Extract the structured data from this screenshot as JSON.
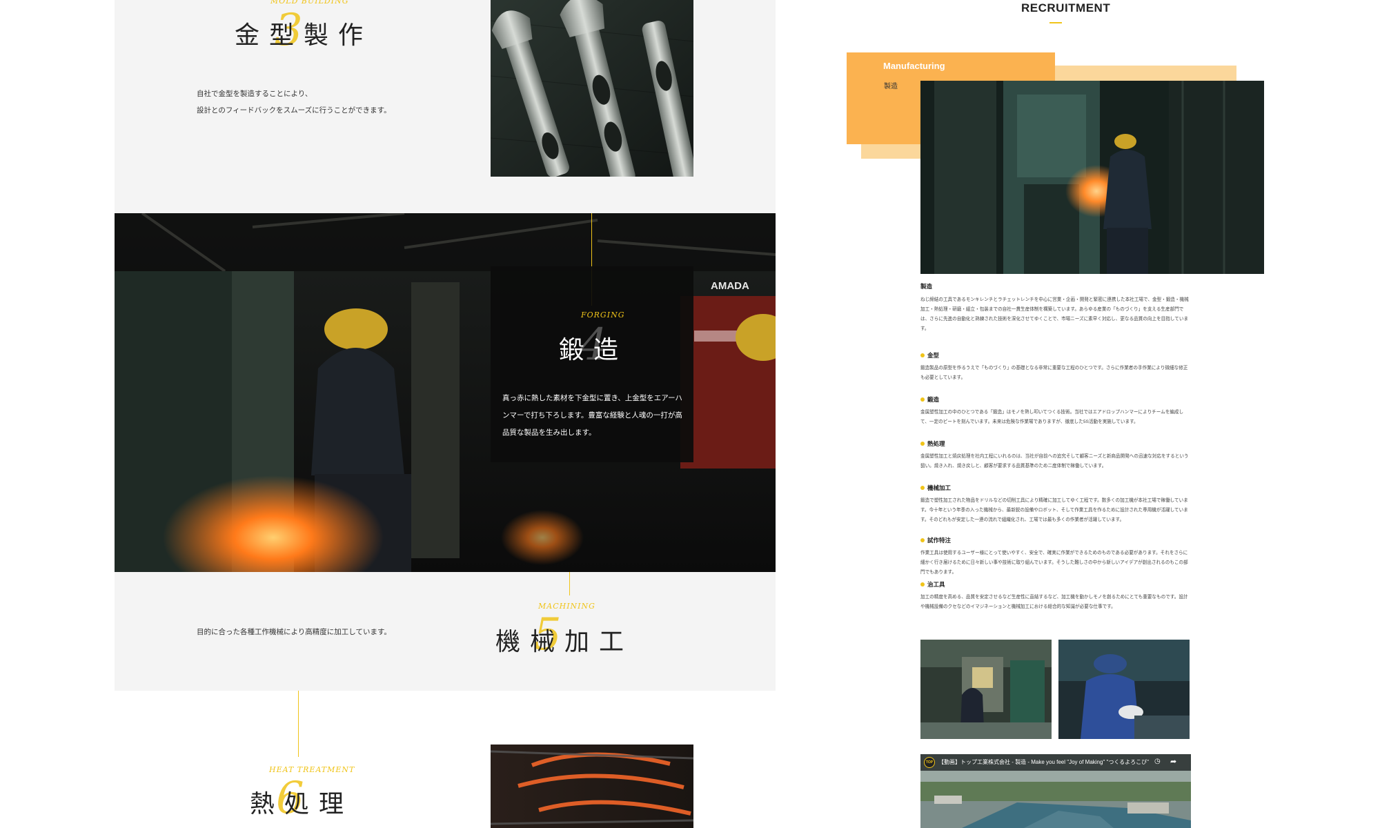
{
  "left": {
    "mold": {
      "en": "MOLD BUILDING",
      "title": "金型製作",
      "number": "3",
      "desc": [
        "自社で金型を製造することにより、",
        "設計とのフィードバックをスムーズに行うことができます。"
      ]
    },
    "forging": {
      "en": "FORGING",
      "title": "鍛造",
      "number": "4",
      "desc": "真っ赤に熱した素材を下金型に置き、上金型をエアーハンマーで打ち下ろします。豊富な経験と人魂の一打が高品質な製品を生み出します。",
      "photo_sign": "AMADA"
    },
    "machining": {
      "en": "MACHINING",
      "title": "機械加工",
      "number": "5",
      "desc": "目的に合った各種工作機械により高精度に加工しています。"
    },
    "heat": {
      "en": "HEAT TREATMENT",
      "title": "熱処理",
      "number": "6"
    }
  },
  "right": {
    "recruitment_title": "RECRUITMENT",
    "manufacturing_label": "Manufacturing",
    "manufacturing_sub": "製造",
    "intro": {
      "heading": "製造",
      "text": "ねじ締結の工具であるモンキレンチとラチェットレンチを中心に営業・企画・開発と緊密に連携した本社工場で、金型・鍛造・機械加工・熱処理・研磨・組立・包装までの自社一貫生産体制を構築しています。あらゆる産業の「ものづくり」を支える生産部門では、さらに先進の自動化と熟練された技術を深化させてゆくことで、市場ニーズに素早く対応し、更なる品質の向上を目指しています。"
    },
    "items": [
      {
        "heading": "金型",
        "text": "鍛造製品の原型を作るうえで「ものづくり」の基礎となる非常に重要な工程のひとつです。さらに作業者の手作業により微細な修正も必要としています。"
      },
      {
        "heading": "鍛造",
        "text": "金属塑性加工の中のひとつである「鍛造」はモノを熱し叩いてつくる技術。当社ではエアドロップハンマーによりチームを編成して、一定のピートを刻んでいます。未来は危険な作業場でありますが、徹底した5S活動を実施しています。"
      },
      {
        "heading": "熱処理",
        "text": "金属塑性加工と焼戻処理を社内工程にいれるのは、当社が自前への追究そして顧客ニーズと新商品開発への迅速な対応をするという狙い。焼き入れ、焼き戻しと、顧客が要求する品質基準のため二度体制で稼働しています。"
      },
      {
        "heading": "機械加工",
        "text": "鍛造で塑性加工された物品をドリルなどの切削工具により精確に加工してゆく工程です。数多くの加工機が本社工場で稼働しています。今十年という年季の入った機械から、最新鋭の設備やロボット、そして作業工具を作るために設計された専用機が活躍しています。そのどれもが安定した一連の流れで組織化され、工場では最も多くの作業者が活躍しています。"
      },
      {
        "heading": "試作特注",
        "text": "作業工具は使用するユーザー様にとって使いやすく、安全で、確実に作業ができるためのものである必要があります。それをさらに細かく行き届けるために日々新しい事や技術に取り組んでいます。そうした難しさの中から新しいアイデアが創出されるのもこの部門でもあります。"
      },
      {
        "heading": "治工具",
        "text": "加工の精度を高める、品質を安定させるなど生産性に直結するなど、加工機を動かしモノを創るためにとても重要なものです。設計や機械設備のクセなどのイマジネーションと機械加工における総合的な知識が必要な仕事です。"
      }
    ],
    "video": {
      "channel_logo": "TOP",
      "title": "【動画】トップ工業株式会社 - 製造 - Make you feel \"Joy of Making\" \"つくるよろこび\""
    }
  }
}
